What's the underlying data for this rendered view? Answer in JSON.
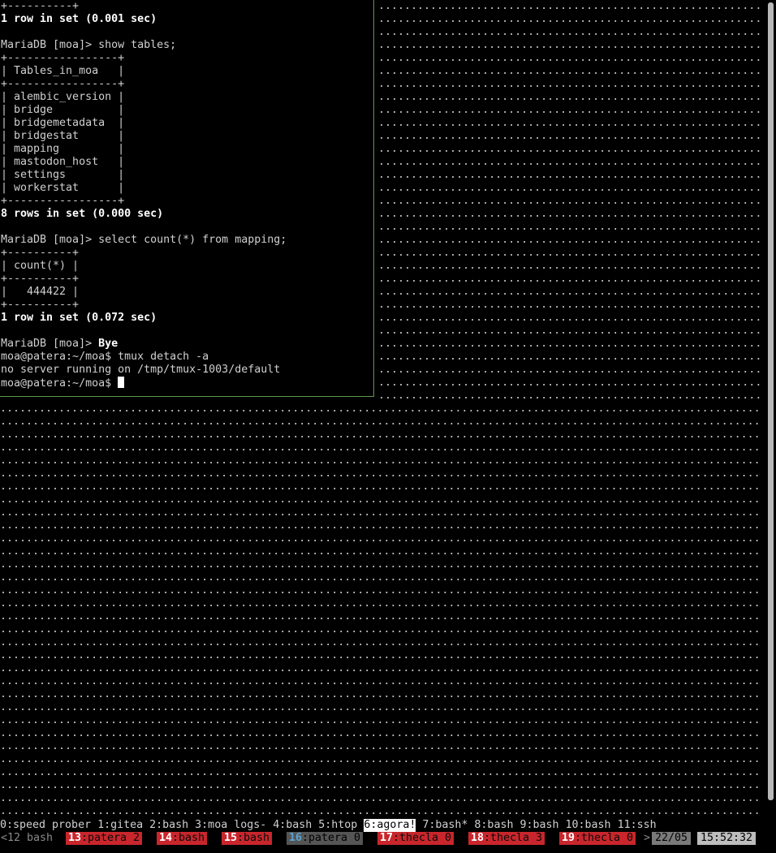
{
  "terminal": {
    "lines": [
      {
        "text": "+----------+"
      },
      {
        "text": "1 row in set (0.001 sec)",
        "bold": true
      },
      {
        "text": ""
      },
      {
        "text": "MariaDB [moa]> show tables;"
      },
      {
        "text": "+-----------------+"
      },
      {
        "text": "| Tables_in_moa   |"
      },
      {
        "text": "+-----------------+"
      },
      {
        "text": "| alembic_version |"
      },
      {
        "text": "| bridge          |"
      },
      {
        "text": "| bridgemetadata  |"
      },
      {
        "text": "| bridgestat      |"
      },
      {
        "text": "| mapping         |"
      },
      {
        "text": "| mastodon_host   |"
      },
      {
        "text": "| settings        |"
      },
      {
        "text": "| workerstat      |"
      },
      {
        "text": "+-----------------+"
      },
      {
        "text": "8 rows in set (0.000 sec)",
        "bold": true
      },
      {
        "text": ""
      },
      {
        "text": "MariaDB [moa]> select count(*) from mapping;"
      },
      {
        "text": "+----------+"
      },
      {
        "text": "| count(*) |"
      },
      {
        "text": "+----------+"
      },
      {
        "text": "|   444422 |"
      },
      {
        "text": "+----------+"
      },
      {
        "text": "1 row in set (0.072 sec)",
        "bold": true
      },
      {
        "text": ""
      },
      {
        "text": "MariaDB [moa]> ",
        "tail_bold": "Bye"
      },
      {
        "text": "moa@patera:~/moa$ tmux detach -a"
      },
      {
        "text": "no server running on /tmp/tmux-1003/default"
      },
      {
        "text": "moa@patera:~/moa$ ",
        "cursor": true
      }
    ]
  },
  "filler_char": ".",
  "windows": [
    {
      "label": "0:speed prober"
    },
    {
      "label": "1:gitea"
    },
    {
      "label": "2:bash"
    },
    {
      "label": "3:moa logs-"
    },
    {
      "label": "4:bash"
    },
    {
      "label": "5:htop"
    },
    {
      "label": "6:agora!",
      "active": true
    },
    {
      "label": "7:bash*"
    },
    {
      "label": "8:bash"
    },
    {
      "label": "9:bash"
    },
    {
      "label": "10:bash"
    },
    {
      "label": "11:ssh"
    }
  ],
  "status": {
    "left_label": "<12 bash",
    "sessions": [
      {
        "num": "13",
        "name": ":patera 2"
      },
      {
        "num": "14",
        "name": ":bash"
      },
      {
        "num": "15",
        "name": ":bash"
      },
      {
        "num": "16",
        "name": ":patera 0",
        "current": true
      },
      {
        "num": "17",
        "name": ":thecla 0"
      },
      {
        "num": "18",
        "name": ":thecla 3"
      },
      {
        "num": "19",
        "name": ":thecla 0"
      }
    ],
    "arrow": ">",
    "date": "22/05",
    "time": "15:52:32"
  },
  "colors": {
    "pane_border": "#5f9a4a",
    "session_bg": "#c8262c",
    "current_session_number": "#5aa4d4"
  }
}
